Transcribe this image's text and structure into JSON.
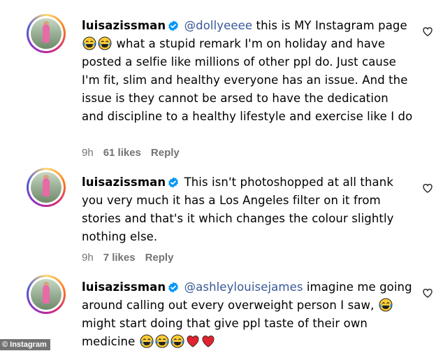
{
  "comments": [
    {
      "username": "luisazissman",
      "mention": "@dollyeeee",
      "body_1": " this is MY Instagram page ",
      "body_2": " what a stupid remark I'm on holiday and have posted a selfie like millions of other ppl do. Just cause I'm fit, slim and healthy everyone has an issue. And the issue is they cannot be arsed to have the dedication and discipline to a healthy lifestyle and exercise like I do",
      "time": "9h",
      "likes": "61 likes",
      "reply": "Reply"
    },
    {
      "username": "luisazissman",
      "mention": "",
      "body_1": " This isn't photoshopped at all thank you very much it has a Los Angeles filter on it from stories and that's it which changes the colour slightly nothing else.",
      "body_2": "",
      "time": "9h",
      "likes": "7 likes",
      "reply": "Reply"
    },
    {
      "username": "luisazissman",
      "mention": "@ashleylouisejames",
      "body_1": " imagine me going around calling out every overweight person I saw, ",
      "body_2": " might start doing that give ppl taste of their own medicine ",
      "time": "",
      "likes": "",
      "reply": ""
    }
  ],
  "emoji": {
    "laughing": "face-with-tears-of-joy",
    "heart": "red-heart"
  },
  "watermark": "© Instagram",
  "colors": {
    "mention": "#385898",
    "meta": "#737373",
    "verified": "#0095f6"
  }
}
